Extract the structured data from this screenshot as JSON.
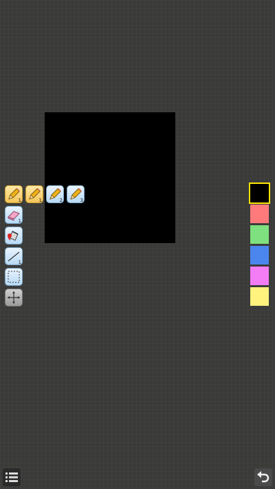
{
  "app": {
    "canvas_color": "#000000",
    "background_color": "#3a3b39"
  },
  "tools": {
    "pencil_sizes": [
      {
        "icon": "pencil-icon",
        "label": "1",
        "selected": true
      },
      {
        "icon": "pencil-icon",
        "label": "1",
        "selected": false,
        "highlight": true
      },
      {
        "icon": "pencil-icon",
        "label": "2",
        "selected": false
      },
      {
        "icon": "pencil-icon",
        "label": "3",
        "selected": false
      }
    ],
    "eraser": {
      "icon": "eraser-icon",
      "label": "1"
    },
    "fill": {
      "icon": "paint-bucket-icon"
    },
    "line": {
      "icon": "line-icon",
      "label": "1"
    },
    "select": {
      "icon": "dashed-rectangle-icon"
    },
    "move": {
      "icon": "move-arrows-icon"
    }
  },
  "palette": {
    "colors": [
      "#000000",
      "#ff7b7b",
      "#7ee07e",
      "#4b86ee",
      "#f47cf4",
      "#fff27d"
    ],
    "selected_index": 0,
    "highlight_color": "#ffe600"
  },
  "bottom_bar": {
    "menu_icon": "list-icon",
    "undo_icon": "undo-icon"
  }
}
